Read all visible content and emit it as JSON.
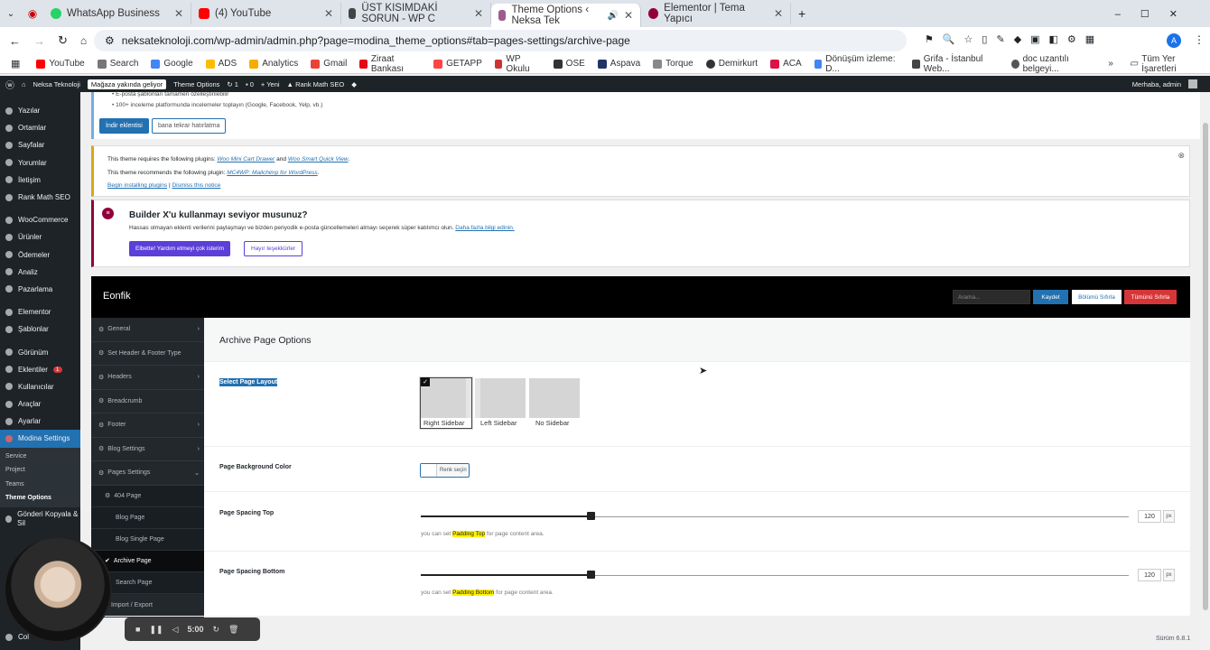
{
  "browser": {
    "tabs": [
      {
        "title": "WhatsApp Business",
        "color": "#25d366"
      },
      {
        "title": "(4) YouTube",
        "color": "#ff0000"
      },
      {
        "title": "ÜST KISIMDAKİ SORUN - WP C",
        "color": "#444444"
      },
      {
        "title": "Theme Options ‹ Neksa Tek",
        "color": "#9b5c8f"
      },
      {
        "title": "Elementor | Tema Yapıcı",
        "color": "#92003b"
      }
    ],
    "url": "neksateknoloji.com/wp-admin/admin.php?page=modina_theme_options#tab=pages-settings/archive-page",
    "bookmarks": [
      "YouTube",
      "Search",
      "Google",
      "ADS",
      "Analytics",
      "Gmail",
      "Ziraat Bankası",
      "GETAPP",
      "WP Okulu",
      "OSE",
      "Aspava",
      "Torque",
      "Demirkurt",
      "ACA",
      "Dönüşüm izleme: D...",
      "Grifa - İstanbul Web...",
      "doc uzantılı belgeyi..."
    ],
    "bookmarks_folder": "Tüm Yer İşaretleri"
  },
  "wpbar": {
    "site": "Neksa Teknoloji",
    "chip": "Mağaza yakında geliyor",
    "theme_options": "Theme Options",
    "updates": "1",
    "comments": "0",
    "new": "Yeni",
    "seo": "Rank Math SEO",
    "greeting": "Merhaba, admin"
  },
  "sidebar": {
    "items": [
      "Yazılar",
      "Ortamlar",
      "Sayfalar",
      "Yorumlar",
      "İletişim",
      "Rank Math SEO",
      "WooCommerce",
      "Ürünler",
      "Ödemeler",
      "Analiz",
      "Pazarlama",
      "Elementor",
      "Şablonlar",
      "Görünüm",
      "Eklentiler",
      "Kullanıcılar",
      "Araçlar",
      "Ayarlar",
      "Modina Settings"
    ],
    "plugin_badge": "1",
    "submenu": [
      "Service",
      "Project",
      "Teams",
      "Theme Options"
    ],
    "after": "Gönderi Kopyala & Sil",
    "bottom": "Col"
  },
  "notices": {
    "top_bullets": [
      "E-posta şablonları tamamen özelleştirilebilir",
      "100+ inceleme platformunda incelemeler toplayın (Google, Facebook, Yelp, vb.)"
    ],
    "install_btn": "İndir eklentisi",
    "remind_btn": "bana tekrar hatırlatma",
    "plugin_line1_pre": "This theme requires the following plugins:",
    "plugin_line1_a": "Woo Mini Cart Drawer",
    "plugin_line1_and": "and",
    "plugin_line1_b": "Woo Smart Quick View",
    "plugin_line2_pre": "This theme recommends the following plugin:",
    "plugin_line2_a": "MC4WP: Mailchimp for WordPress",
    "begin": "Begin installing plugins",
    "sep": "|",
    "dismiss": "Dismiss this notice",
    "builder_title": "Builder X'u kullanmayı seviyor musunuz?",
    "builder_text": "Hassas olmayan eklenti verilerini paylaşmayı ve bizden periyodik e-posta güncellemeleri almayı seçerek süper katılımcı olun.",
    "builder_link": "Daha fazla bilgi edinin.",
    "yes_btn": "Elbette! Yardım etmeyi çok isterim",
    "no_btn": "Hayır teşekkürler"
  },
  "panel": {
    "brand": "Eonfik",
    "search_placeholder": "Arama...",
    "save": "Kaydet",
    "reset_section": "Bölümü Sıfırla",
    "reset_all": "Tümünü Sıfırla",
    "nav": [
      "General",
      "Set Header & Footer Type",
      "Headers",
      "Breadcrumb",
      "Footer",
      "Blog Settings",
      "Pages Settings"
    ],
    "sub_nav": [
      "404 Page",
      "Blog Page",
      "Blog Single Page",
      "Archive Page",
      "Search Page"
    ],
    "import_export": "Import / Export",
    "section_title": "Archive Page Options",
    "layout_label": "Select Page Layout",
    "layouts": [
      "Right Sidebar",
      "Left Sidebar",
      "No Sidebar"
    ],
    "bg_label": "Page Background Color",
    "bg_btn": "Renk seçin",
    "spacing_top_label": "Page Spacing Top",
    "spacing_top_value": "120",
    "spacing_top_fill": 0.24,
    "spacing_bottom_label": "Page Spacing Bottom",
    "spacing_bottom_value": "120",
    "spacing_bottom_fill": 0.24,
    "unit": "px",
    "hint_pre": "you can set",
    "hint_top": "Padding Top",
    "hint_bottom": "Padding Bottom",
    "hint_post": "for page content area."
  },
  "recorder": {
    "time": "5:00"
  },
  "footer": {
    "version": "Sürüm 6.8.1"
  }
}
